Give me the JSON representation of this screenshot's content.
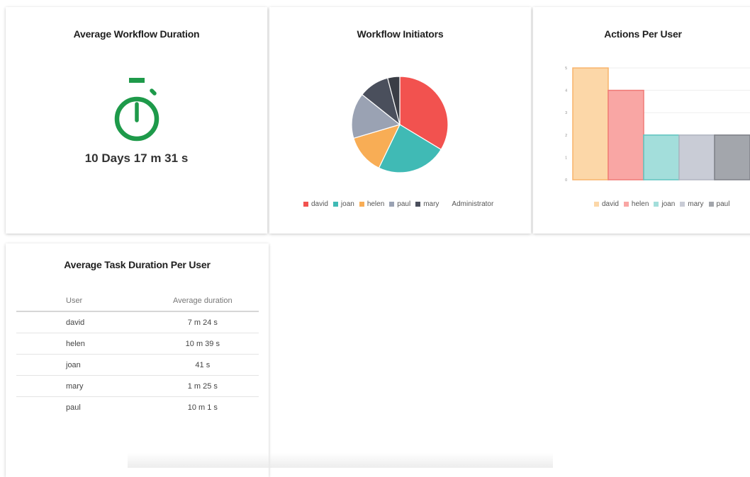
{
  "cards": {
    "duration": {
      "title": "Average Workflow Duration",
      "value": "10 Days 17 m 31 s",
      "icon": "stopwatch-icon",
      "icon_color": "#1e9a4a"
    },
    "initiators": {
      "title": "Workflow Initiators",
      "legend": [
        {
          "label": "david",
          "color": "#f2524f"
        },
        {
          "label": "joan",
          "color": "#40bab5"
        },
        {
          "label": "helen",
          "color": "#f8ad55"
        },
        {
          "label": "paul",
          "color": "#9aa2b3"
        },
        {
          "label": "mary",
          "color": "#4a4f5c"
        },
        {
          "label": "Administrator",
          "color": "#ffffff"
        }
      ]
    },
    "actions": {
      "title": "Actions Per User",
      "legend": [
        {
          "label": "david",
          "color": "#fcd7a8"
        },
        {
          "label": "helen",
          "color": "#f9a6a4"
        },
        {
          "label": "joan",
          "color": "#a3dedb"
        },
        {
          "label": "mary",
          "color": "#c9ccd6"
        },
        {
          "label": "paul",
          "color": "#a3a6ac"
        }
      ]
    },
    "task": {
      "title": "Average Task Duration Per User",
      "headers": {
        "user": "User",
        "duration": "Average duration"
      },
      "rows": [
        {
          "user": "david",
          "duration": "7 m 24 s"
        },
        {
          "user": "helen",
          "duration": "10 m 39 s"
        },
        {
          "user": "joan",
          "duration": "41 s"
        },
        {
          "user": "mary",
          "duration": "1 m 25 s"
        },
        {
          "user": "paul",
          "duration": "10 m 1 s"
        }
      ]
    }
  },
  "chart_data": [
    {
      "type": "pie",
      "title": "Workflow Initiators",
      "categories": [
        "david",
        "joan",
        "helen",
        "paul",
        "mary",
        "Administrator"
      ],
      "values": [
        33,
        23,
        13,
        15,
        10,
        4
      ],
      "colors": [
        "#f2524f",
        "#40bab5",
        "#f8ad55",
        "#9aa2b3",
        "#4a4f5c",
        "#3a3d45"
      ]
    },
    {
      "type": "bar",
      "title": "Actions Per User",
      "categories": [
        "david",
        "helen",
        "joan",
        "mary",
        "paul"
      ],
      "values": [
        5,
        4,
        2,
        2,
        2
      ],
      "ylim": [
        0,
        5
      ],
      "colors": [
        "#fcd7a8",
        "#f9a6a4",
        "#a3dedb",
        "#c9ccd6",
        "#a3a6ac"
      ],
      "border_colors": [
        "#f8b46a",
        "#f07a77",
        "#5fc4bf",
        "#b0b4c0",
        "#7e8188"
      ],
      "grid": true
    }
  ]
}
